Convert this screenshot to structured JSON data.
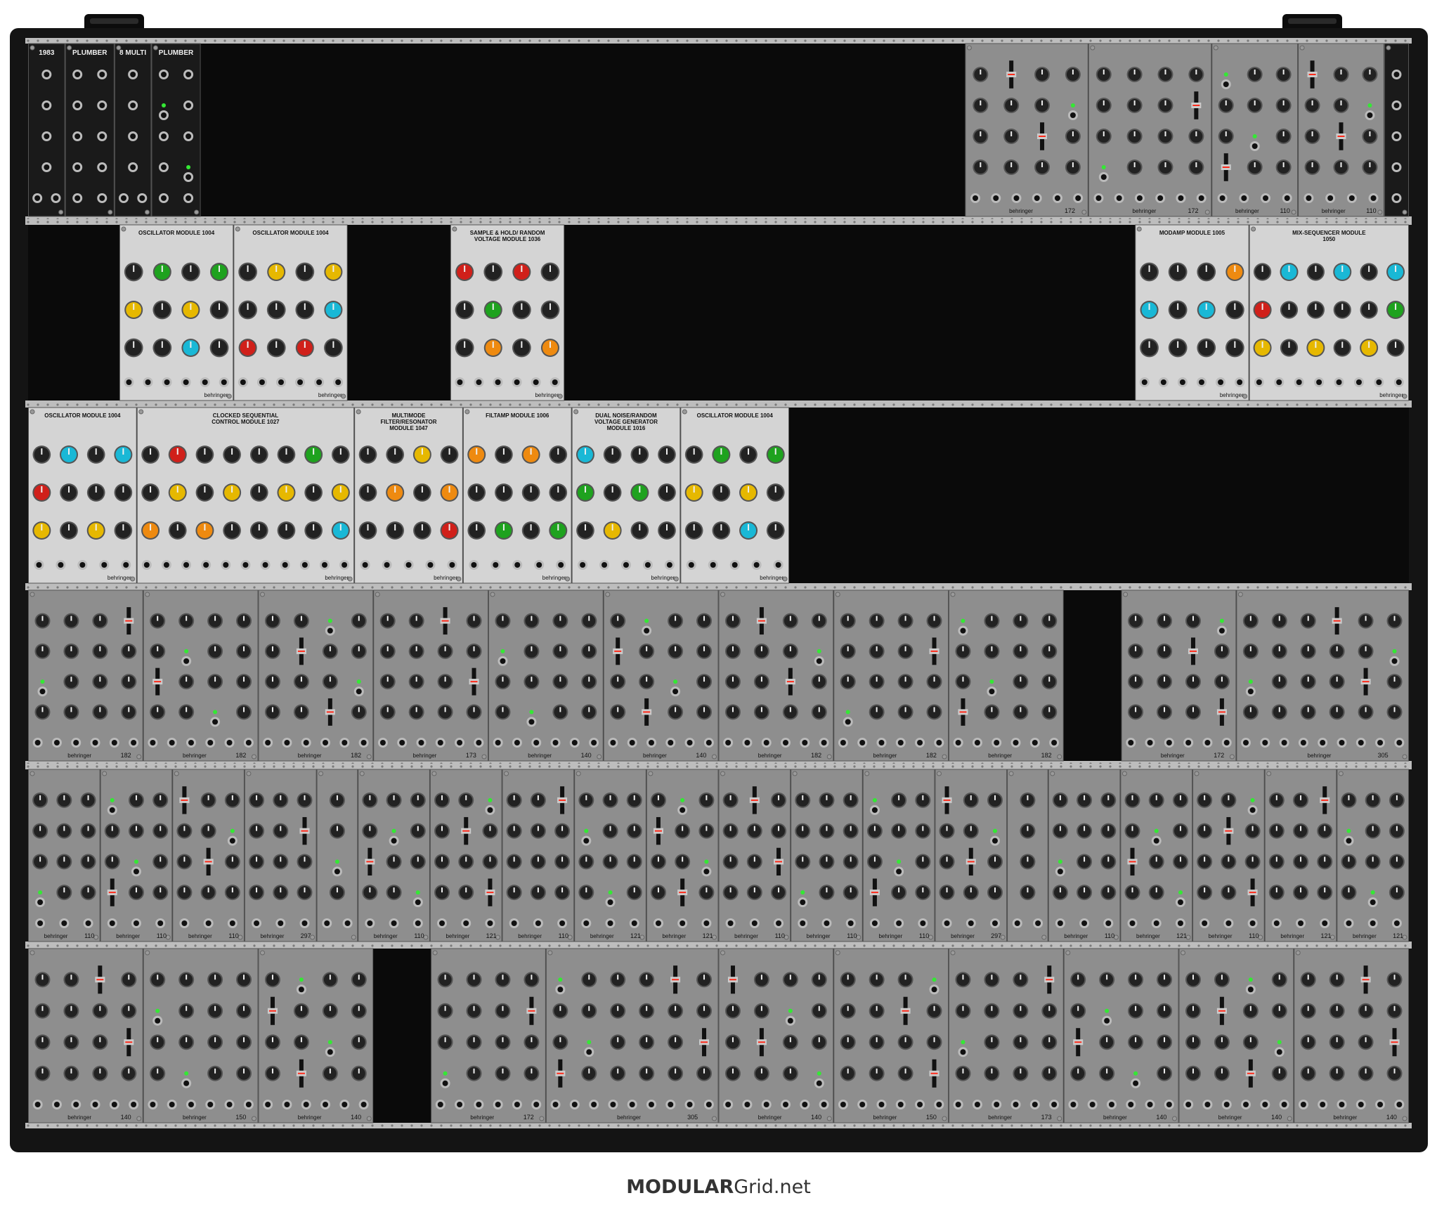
{
  "site": {
    "brand_bold": "MODULAR",
    "brand_regular": "Grid.net"
  },
  "colors": {
    "case": "#141414",
    "rail": "#bdbdbd",
    "panel_silver": "#d4d4d4",
    "panel_gray": "#8e8e8e",
    "panel_dark": "#1a1a1a",
    "knob": "#222222",
    "jack": "#2c2c2c",
    "cap_red": "#d0201a",
    "cap_green": "#1ea21e",
    "cap_yellow": "#e6b800",
    "cap_orange": "#ee8a10",
    "cap_cyan": "#19b8d6",
    "led_green": "#34e834",
    "led_red": "#ff2a1a"
  },
  "rows": [
    {
      "modules": [
        {
          "label": "1983",
          "style": "dark",
          "w": 3
        },
        {
          "label": "PLUMBER",
          "style": "dark",
          "w": 4
        },
        {
          "label": "8 MULTI",
          "style": "dark",
          "w": 3
        },
        {
          "label": "PLUMBER",
          "style": "dark",
          "w": 4
        },
        {
          "label": "",
          "style": "blank",
          "w": 62
        },
        {
          "label": "172",
          "style": "gray",
          "w": 10
        },
        {
          "label": "172",
          "style": "gray",
          "w": 10
        },
        {
          "label": "110",
          "style": "gray",
          "w": 7
        },
        {
          "label": "110",
          "style": "gray",
          "w": 7
        },
        {
          "label": "",
          "style": "dark",
          "w": 2
        }
      ]
    },
    {
      "modules": [
        {
          "label": "",
          "style": "blank",
          "w": 8
        },
        {
          "label": "OSCILLATOR MODULE 1004",
          "style": "silver",
          "w": 10
        },
        {
          "label": "OSCILLATOR MODULE 1004",
          "style": "silver",
          "w": 10
        },
        {
          "label": "",
          "style": "blank",
          "w": 9
        },
        {
          "label": "SAMPLE & HOLD/ RANDOM VOLTAGE MODULE 1036",
          "style": "silver",
          "w": 10
        },
        {
          "label": "",
          "style": "blank",
          "w": 50
        },
        {
          "label": "MODAMP MODULE 1005",
          "style": "silver",
          "w": 10
        },
        {
          "label": "MIX-SEQUENCER MODULE 1050",
          "style": "silver",
          "w": 14
        }
      ]
    },
    {
      "modules": [
        {
          "label": "OSCILLATOR MODULE 1004",
          "style": "silver",
          "w": 10
        },
        {
          "label": "CLOCKED SEQUENTIAL CONTROL MODULE 1027",
          "style": "silver",
          "w": 20
        },
        {
          "label": "MULTIMODE FILTER/RESONATOR MODULE 1047",
          "style": "silver",
          "w": 10
        },
        {
          "label": "FILTAMP MODULE 1006",
          "style": "silver",
          "w": 10
        },
        {
          "label": "DUAL NOISE/RANDOM VOLTAGE GENERATOR MODULE 1016",
          "style": "silver",
          "w": 10
        },
        {
          "label": "OSCILLATOR MODULE 1004",
          "style": "silver",
          "w": 10
        },
        {
          "label": "",
          "style": "blank",
          "w": 57
        }
      ]
    },
    {
      "modules": [
        {
          "label": "182",
          "style": "gray",
          "w": 10
        },
        {
          "label": "182",
          "style": "gray",
          "w": 10
        },
        {
          "label": "182",
          "style": "gray",
          "w": 10
        },
        {
          "label": "173",
          "style": "gray",
          "w": 10
        },
        {
          "label": "140",
          "style": "gray",
          "w": 10
        },
        {
          "label": "140",
          "style": "gray",
          "w": 10
        },
        {
          "label": "182",
          "style": "gray",
          "w": 10
        },
        {
          "label": "182",
          "style": "gray",
          "w": 10
        },
        {
          "label": "182",
          "style": "gray",
          "w": 10
        },
        {
          "label": "",
          "style": "blank",
          "w": 5
        },
        {
          "label": "172",
          "style": "gray",
          "w": 10
        },
        {
          "label": "305",
          "style": "gray",
          "w": 15
        }
      ]
    },
    {
      "modules": [
        {
          "label": "110",
          "style": "gray",
          "w": 7
        },
        {
          "label": "110",
          "style": "gray",
          "w": 7
        },
        {
          "label": "110",
          "style": "gray",
          "w": 7
        },
        {
          "label": "297",
          "style": "gray",
          "w": 7
        },
        {
          "label": "",
          "style": "gray",
          "w": 4
        },
        {
          "label": "110",
          "style": "gray",
          "w": 7
        },
        {
          "label": "121",
          "style": "gray",
          "w": 7
        },
        {
          "label": "110",
          "style": "gray",
          "w": 7
        },
        {
          "label": "121",
          "style": "gray",
          "w": 7
        },
        {
          "label": "121",
          "style": "gray",
          "w": 7
        },
        {
          "label": "110",
          "style": "gray",
          "w": 7
        },
        {
          "label": "110",
          "style": "gray",
          "w": 7
        },
        {
          "label": "110",
          "style": "gray",
          "w": 7
        },
        {
          "label": "297",
          "style": "gray",
          "w": 7
        },
        {
          "label": "",
          "style": "gray",
          "w": 4
        },
        {
          "label": "110",
          "style": "gray",
          "w": 7
        },
        {
          "label": "121",
          "style": "gray",
          "w": 7
        },
        {
          "label": "110",
          "style": "gray",
          "w": 7
        },
        {
          "label": "121",
          "style": "gray",
          "w": 7
        },
        {
          "label": "121",
          "style": "gray",
          "w": 7
        }
      ]
    },
    {
      "modules": [
        {
          "label": "140",
          "style": "gray",
          "w": 10
        },
        {
          "label": "150",
          "style": "gray",
          "w": 10
        },
        {
          "label": "140",
          "style": "gray",
          "w": 10
        },
        {
          "label": "",
          "style": "blank",
          "w": 5
        },
        {
          "label": "172",
          "style": "gray",
          "w": 10
        },
        {
          "label": "305",
          "style": "gray",
          "w": 15
        },
        {
          "label": "140",
          "style": "gray",
          "w": 10
        },
        {
          "label": "150",
          "style": "gray",
          "w": 10
        },
        {
          "label": "173",
          "style": "gray",
          "w": 10
        },
        {
          "label": "140",
          "style": "gray",
          "w": 10
        },
        {
          "label": "140",
          "style": "gray",
          "w": 10
        },
        {
          "label": "140",
          "style": "gray",
          "w": 10
        }
      ]
    }
  ]
}
